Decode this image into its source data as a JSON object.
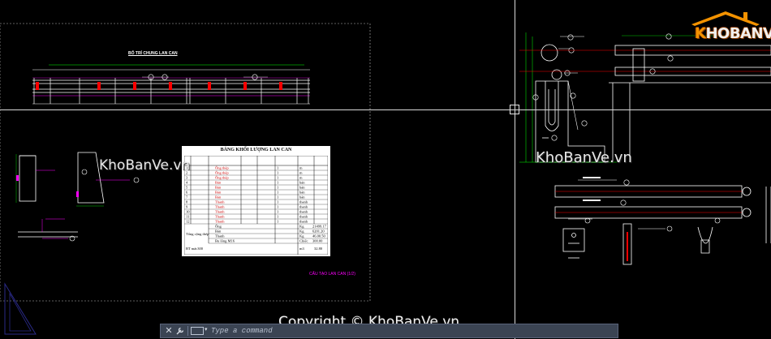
{
  "drawing": {
    "sheet_title": "BỐ TRÍ CHUNG LAN CAN",
    "sub_caption": "CẤU TẠO LAN CAN (1/2)"
  },
  "table": {
    "title": "BẢNG KHỐI LƯỢNG LAN CAN",
    "rows": [
      [
        "1",
        "",
        "Ống thép",
        "",
        "",
        "1",
        "m",
        ""
      ],
      [
        "2",
        "",
        "Ống thép",
        "",
        "",
        "1",
        "m",
        ""
      ],
      [
        "3",
        "",
        "Ống thép",
        "",
        "",
        "1",
        "m",
        ""
      ],
      [
        "4",
        "",
        "Bản",
        "",
        "",
        "1",
        "bản",
        ""
      ],
      [
        "5",
        "",
        "Bản",
        "",
        "",
        "1",
        "bản",
        ""
      ],
      [
        "6",
        "",
        "Bản",
        "",
        "",
        "1",
        "bản",
        ""
      ],
      [
        "7",
        "",
        "Bản",
        "",
        "",
        "1",
        "bản",
        ""
      ],
      [
        "8",
        "",
        "Thanh",
        "",
        "",
        "1",
        "thanh",
        ""
      ],
      [
        "9",
        "",
        "Thanh",
        "",
        "",
        "1",
        "thanh",
        ""
      ],
      [
        "10",
        "",
        "Thanh",
        "",
        "",
        "1",
        "thanh",
        ""
      ],
      [
        "11",
        "",
        "Thanh",
        "",
        "",
        "1",
        "thanh",
        ""
      ],
      [
        "12",
        "",
        "Thanh",
        "",
        "",
        "1",
        "thanh",
        ""
      ]
    ],
    "totals_label": "Tổng cộng thép",
    "totals": [
      {
        "label": "Ống",
        "unit": "Kg",
        "value": "21499.17"
      },
      {
        "label": "Bản",
        "unit": "Kg",
        "value": "6201.20"
      },
      {
        "label": "Thanh",
        "unit": "Kg",
        "value": "46.00.50"
      },
      {
        "label": "Bu lông M16",
        "unit": "Chiếc",
        "value": "300.00"
      }
    ],
    "footer_label": "BT mác300",
    "footer_unit": "m3",
    "footer_value": "32.80"
  },
  "watermarks": [
    "KhoBanVe.vn",
    "KhoBanVe.vn"
  ],
  "logo": {
    "brand_k": "K",
    "brand_rest": "HOBANVE"
  },
  "copyright": "Copyright © KhoBanVe.vn",
  "command_line": {
    "placeholder": "Type a command",
    "close_icon": "✕",
    "wrench_icon": "🔧"
  },
  "colors": {
    "background": "#000000",
    "magenta": "#ff00ff",
    "cyan": "#00ffff",
    "green": "#00ff00",
    "white": "#ffffff"
  }
}
